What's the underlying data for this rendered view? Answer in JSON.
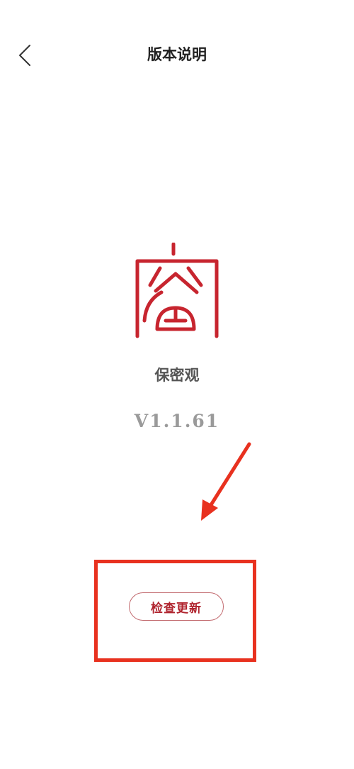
{
  "header": {
    "title": "版本说明",
    "back_icon": "chevron-left-icon"
  },
  "app": {
    "logo_icon": "seal-logo-icon",
    "logo_color": "#c7252f",
    "name": "保密观",
    "version": "V1.1.61"
  },
  "actions": {
    "check_update_label": "检查更新"
  },
  "annotation": {
    "color": "#e8311f",
    "arrow_icon": "red-arrow-icon"
  }
}
